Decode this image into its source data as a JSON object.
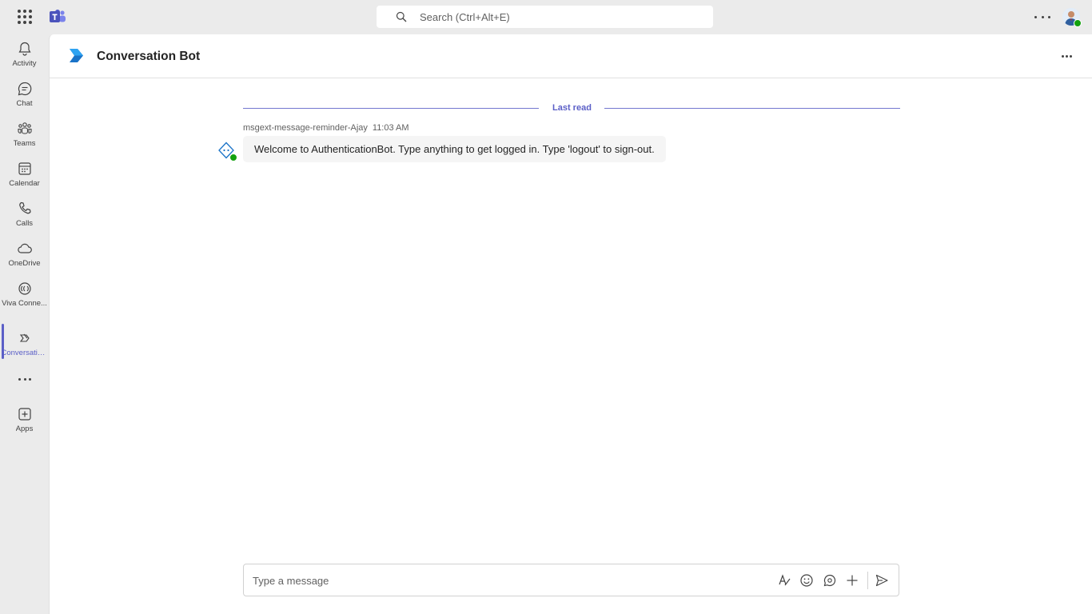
{
  "topbar": {
    "search_placeholder": "Search (Ctrl+Alt+E)",
    "icons": [
      "app-launcher-icon",
      "teams-logo-icon",
      "search-icon",
      "more-icon",
      "avatar"
    ]
  },
  "rail": {
    "items": [
      {
        "label": "Activity",
        "icon": "bell-icon"
      },
      {
        "label": "Chat",
        "icon": "chat-icon"
      },
      {
        "label": "Teams",
        "icon": "teams-icon"
      },
      {
        "label": "Calendar",
        "icon": "calendar-icon"
      },
      {
        "label": "Calls",
        "icon": "phone-icon"
      },
      {
        "label": "OneDrive",
        "icon": "cloud-icon"
      },
      {
        "label": "Viva Conne...",
        "icon": "viva-icon"
      },
      {
        "label": "Conversatio...",
        "icon": "bot-icon",
        "active": true
      },
      {
        "label": "Apps",
        "icon": "add-apps-icon"
      }
    ]
  },
  "header": {
    "title": "Conversation Bot"
  },
  "chat": {
    "last_read": "Last read",
    "message": {
      "sender": "msgext-message-reminder-Ajay",
      "time": "11:03 AM",
      "text": "Welcome to AuthenticationBot. Type anything to get logged in. Type 'logout' to sign-out."
    }
  },
  "composer": {
    "placeholder": "Type a message"
  },
  "colors": {
    "accent": "#5b5fc7",
    "presence": "#13a10e",
    "rail_bg": "#ebebeb",
    "bubble_bg": "#f5f5f5"
  }
}
